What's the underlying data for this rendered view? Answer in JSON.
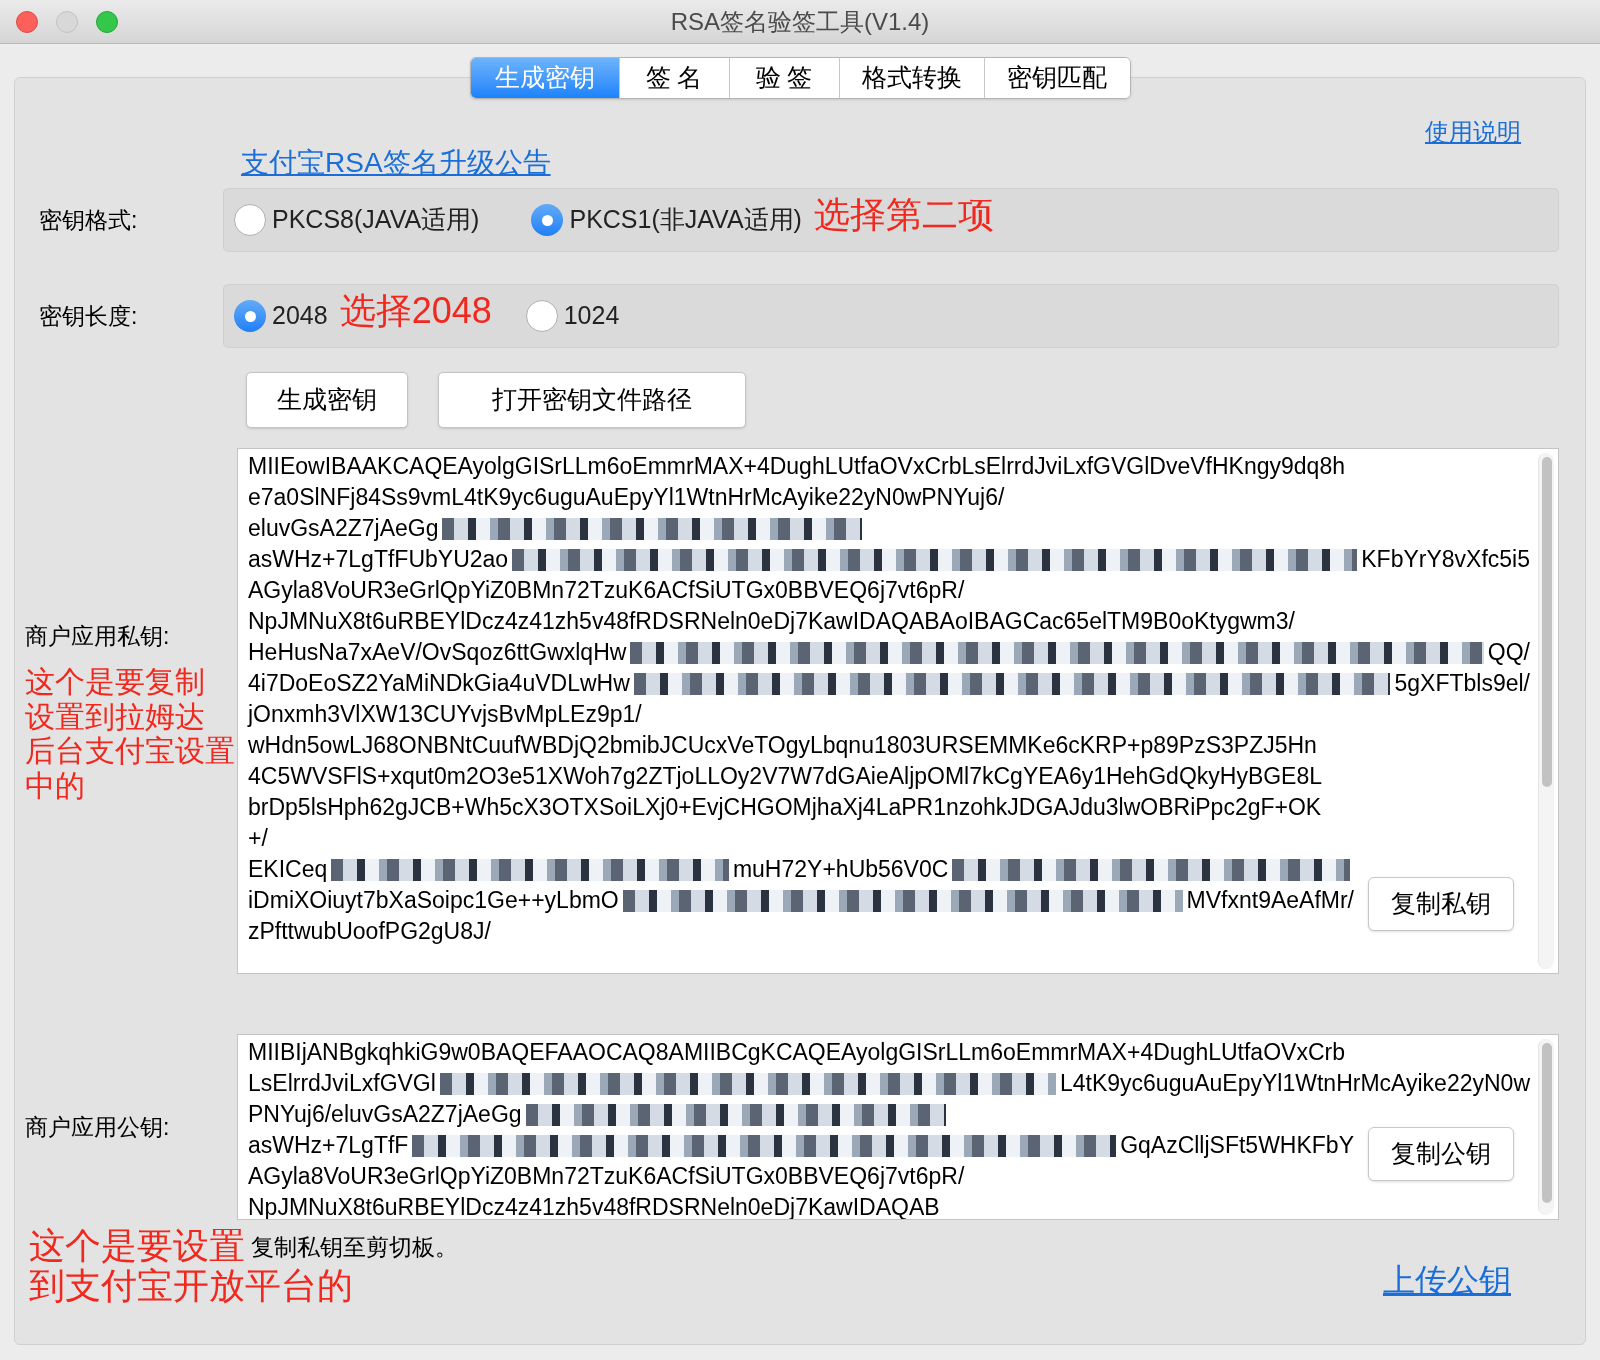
{
  "window": {
    "title": "RSA签名验签工具(V1.4)"
  },
  "tabs": [
    {
      "label": "生成密钥",
      "selected": true
    },
    {
      "label": "签 名",
      "selected": false
    },
    {
      "label": "验 签",
      "selected": false
    },
    {
      "label": "格式转换",
      "selected": false
    },
    {
      "label": "密钥匹配",
      "selected": false
    }
  ],
  "help_link": "使用说明",
  "notice_link": "支付宝RSA签名升级公告",
  "key_format": {
    "label": "密钥格式:",
    "options": [
      {
        "label": "PKCS8(JAVA适用)",
        "selected": false
      },
      {
        "label": "PKCS1(非JAVA适用)",
        "selected": true,
        "annotation": "选择第二项"
      }
    ]
  },
  "key_length": {
    "label": "密钥长度:",
    "options": [
      {
        "label": "2048",
        "selected": true,
        "annotation": "选择2048"
      },
      {
        "label": "1024",
        "selected": false
      }
    ]
  },
  "buttons": [
    "生成密钥",
    "打开密钥文件路径"
  ],
  "private_key": {
    "label": "商户应用私钥:",
    "annotation": [
      "这个是要复制",
      "设置到拉姆达",
      "后台支付宝设置",
      "中的"
    ],
    "copy_button": "复制私钥",
    "lines": [
      [
        {
          "kind": "text",
          "text": "MIIEowIBAAKCAQEAyolgGISrLLm6oEmmrMAX+4DughLUtfaOVxCrbLsElrrdJviLxfGVGlDveVfHKngy9dq8h"
        }
      ],
      [
        {
          "kind": "text",
          "text": "e7a0SlNFj84Ss9vmL4tK9yc6uguAuEpyYl1WtnHrMcAyike22yN0wPNYuj6/"
        }
      ],
      [
        {
          "kind": "text",
          "text": "eluvGsA2Z7jAeGg"
        },
        {
          "kind": "redacted"
        }
      ],
      [
        {
          "kind": "text",
          "text": "asWHz+7LgTfFUbYU2ao"
        },
        {
          "kind": "redacted"
        },
        {
          "kind": "text",
          "text": "KFbYrY8vXfc5i5"
        }
      ],
      [
        {
          "kind": "text",
          "text": "AGyla8VoUR3eGrlQpYiZ0BMn72TzuK6ACfSiUTGx0BBVEQ6j7vt6pR/"
        }
      ],
      [
        {
          "kind": "text",
          "text": "NpJMNuX8t6uRBEYlDcz4z41zh5v48fRDSRNeln0eDj7KawIDAQABAoIBAGCac65elTM9B0oKtygwm3/"
        }
      ],
      [
        {
          "kind": "text",
          "text": "HeHusNa7xAeV/OvSqoz6ttGwxlqHw"
        },
        {
          "kind": "redacted"
        },
        {
          "kind": "text",
          "text": "QQ/"
        }
      ],
      [
        {
          "kind": "text",
          "text": "4i7DoEoSZ2YaMiNDkGia4uVDLwHw"
        },
        {
          "kind": "redacted"
        },
        {
          "kind": "text",
          "text": "5gXFTbls9el/"
        }
      ],
      [
        {
          "kind": "text",
          "text": "jOnxmh3VlXW13CUYvjsBvMpLEz9p1/"
        }
      ],
      [
        {
          "kind": "text",
          "text": "wHdn5owLJ68ONBNtCuufWBDjQ2bmibJCUcxVeTOgyLbqnu1803URSEMMKe6cKRP+p89PzS3PZJ5Hn"
        }
      ],
      [
        {
          "kind": "text",
          "text": "4C5WVSFlS+xqut0m2O3e51XWoh7g2ZTjoLLOy2V7W7dGAieAljpOMl7kCgYEA6y1HehGdQkyHyBGE8L"
        }
      ],
      [
        {
          "kind": "text",
          "text": "brDp5lsHph62gJCB+Wh5cX3OTXSoiLXj0+EvjCHGOMjhaXj4LaPR1nzohkJDGAJdu3lwOBRiPpc2gF+OK"
        }
      ],
      [
        {
          "kind": "text",
          "text": "+/"
        }
      ],
      [
        {
          "kind": "text",
          "text": "EKICeq"
        },
        {
          "kind": "redacted"
        },
        {
          "kind": "text",
          "text": "muH72Y+hUb56V0C"
        },
        {
          "kind": "redacted"
        }
      ],
      [
        {
          "kind": "text",
          "text": "iDmiXOiuyt7bXaSoipc1Ge++yLbmO"
        },
        {
          "kind": "redacted"
        },
        {
          "kind": "text",
          "text": "MVfxnt9AeAfMr/"
        }
      ],
      [
        {
          "kind": "text",
          "text": "zPfttwubUoofPG2gU8J/"
        }
      ]
    ]
  },
  "public_key": {
    "label": "商户应用公钥:",
    "copy_button": "复制公钥",
    "lines": [
      [
        {
          "kind": "text",
          "text": "MIIBIjANBgkqhkiG9w0BAQEFAAOCAQ8AMIIBCgKCAQEAyolgGISrLLm6oEmmrMAX+4DughLUtfaOVxCrb"
        }
      ],
      [
        {
          "kind": "text",
          "text": "LsElrrdJviLxfGVGl"
        },
        {
          "kind": "redacted"
        },
        {
          "kind": "text",
          "text": "L4tK9yc6uguAuEpyYl1WtnHrMcAyike22yN0w"
        }
      ],
      [
        {
          "kind": "text",
          "text": "PNYuj6/eluvGsA2Z7jAeGg"
        },
        {
          "kind": "redacted"
        }
      ],
      [
        {
          "kind": "text",
          "text": "asWHz+7LgTfF"
        },
        {
          "kind": "redacted"
        },
        {
          "kind": "text",
          "text": "GqAzClljSFt5WHKFbY"
        }
      ],
      [
        {
          "kind": "text",
          "text": "AGyla8VoUR3eGrlQpYiZ0BMn72TzuK6ACfSiUTGx0BBVEQ6j7vt6pR/"
        }
      ],
      [
        {
          "kind": "text",
          "text": "NpJMNuX8t6uRBEYlDcz4z41zh5v48fRDSRNeln0eDj7KawIDAQAB"
        }
      ]
    ]
  },
  "bottom_annotation": [
    "这个是要设置",
    "到支付宝开放平台的"
  ],
  "status": "复制私钥至剪切板。",
  "upload_link": "上传公钥"
}
